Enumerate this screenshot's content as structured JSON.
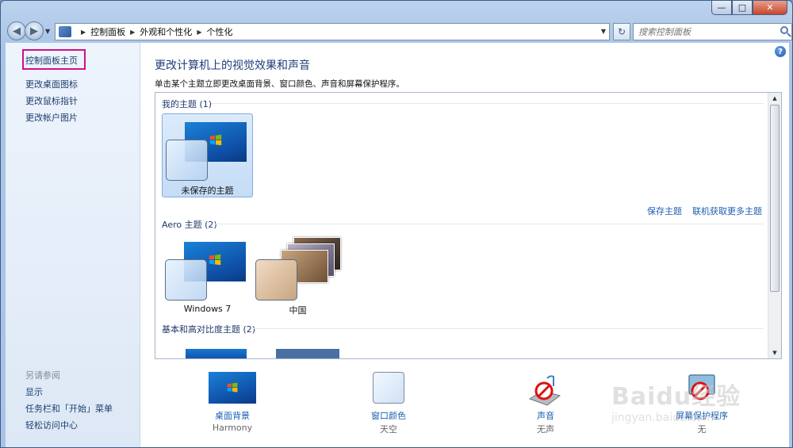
{
  "window": {
    "controls": {
      "minimize": "—",
      "maximize": "□",
      "close": "✕"
    }
  },
  "address_bar": {
    "crumbs": [
      "控制面板",
      "外观和个性化",
      "个性化"
    ]
  },
  "search": {
    "placeholder": "搜索控制面板"
  },
  "left_pane": {
    "home": "控制面板主页",
    "links": [
      "更改桌面图标",
      "更改鼠标指针",
      "更改帐户图片"
    ],
    "see_also_title": "另请参阅",
    "see_also": [
      "显示",
      "任务栏和「开始」菜单",
      "轻松访问中心"
    ]
  },
  "main": {
    "title": "更改计算机上的视觉效果和声音",
    "subtitle": "单击某个主题立即更改桌面背景、窗口颜色、声音和屏幕保护程序。",
    "groups": [
      {
        "title": "我的主题 (1)",
        "themes": [
          "未保存的主题"
        ]
      },
      {
        "title": "Aero 主题 (2)",
        "themes": [
          "Windows 7",
          "中国"
        ]
      },
      {
        "title": "基本和高对比度主题 (2)",
        "themes": []
      }
    ],
    "links": {
      "save": "保存主题",
      "more": "联机获取更多主题"
    }
  },
  "bottom": {
    "background": {
      "label": "桌面背景",
      "value": "Harmony"
    },
    "color": {
      "label": "窗口颜色",
      "value": "天空"
    },
    "sound": {
      "label": "声音",
      "value": "无声"
    },
    "saver": {
      "label": "屏幕保护程序",
      "value": "无"
    }
  },
  "watermark": {
    "text": "Baidu经验",
    "url": "jingyan.baidu.com"
  },
  "icons": {
    "back": "back-arrow-icon",
    "forward": "forward-arrow-icon",
    "refresh": "refresh-icon",
    "search": "search-icon",
    "help": "help-icon"
  },
  "colors": {
    "accent_highlight": "#d10e8b",
    "link": "#1d5fb4",
    "title": "#1f3d7a"
  }
}
